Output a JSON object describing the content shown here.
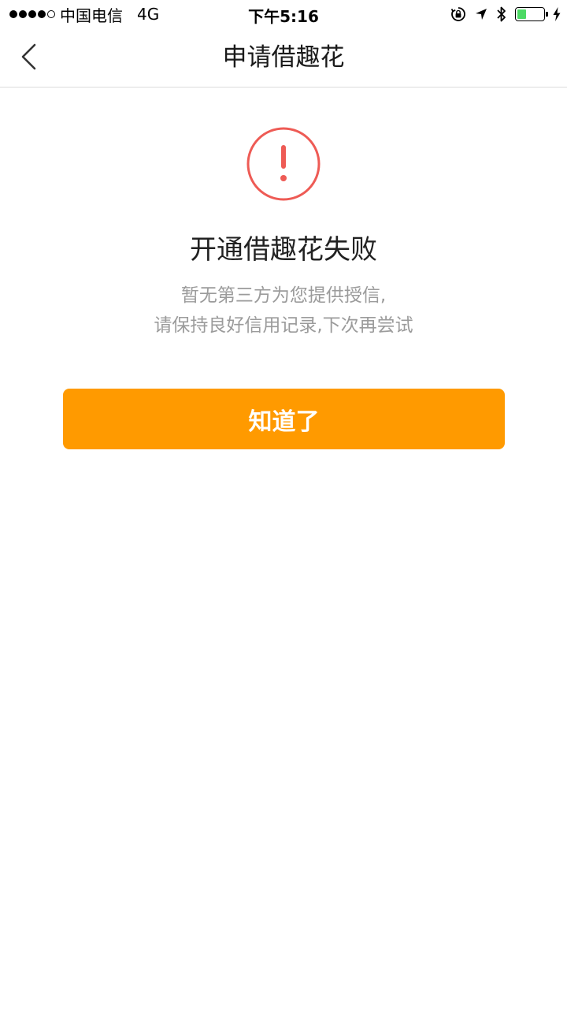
{
  "status_bar": {
    "carrier": "中国电信",
    "network": "4G",
    "time": "下午5:16",
    "battery_level": 0.35,
    "battery_color": "#4cd964",
    "signal_strength": 4,
    "signal_max": 5,
    "icons": [
      "orientation-lock-icon",
      "location-arrow-icon",
      "bluetooth-icon",
      "battery-icon",
      "charging-bolt-icon"
    ]
  },
  "nav": {
    "title": "申请借趣花",
    "back_icon": "chevron-left-icon"
  },
  "result": {
    "icon": "exclamation-circle-icon",
    "icon_color": "#ee5b55",
    "title": "开通借趣花失败",
    "desc_line1": "暂无第三方为您提供授信,",
    "desc_line2": "请保持良好信用记录,下次再尝试"
  },
  "action": {
    "button_label": "知道了",
    "button_color": "#ff9a00"
  }
}
